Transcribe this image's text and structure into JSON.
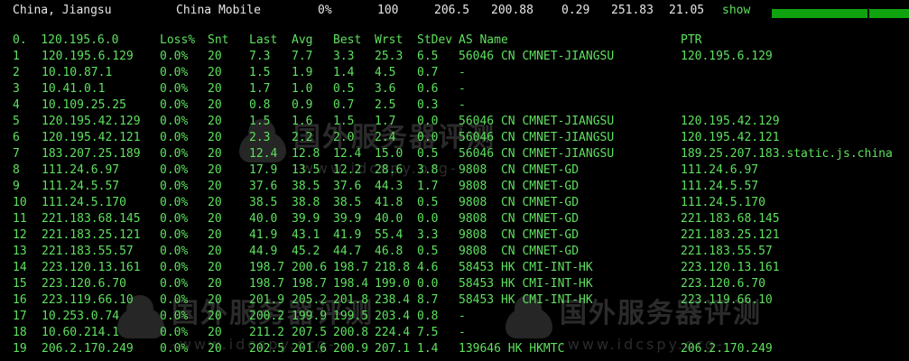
{
  "summary": {
    "location": "China, Jiangsu",
    "isp": "China Mobile",
    "loss": "0%",
    "sent": "100",
    "last": "206.5",
    "avg": "200.88",
    "best": "0.29",
    "worst": "251.83",
    "stdev": "21.05",
    "show_label": "show"
  },
  "columns": {
    "host": "0.  120.195.6.0",
    "loss": "Loss%",
    "snt": "Snt",
    "last": "Last",
    "avg": "Avg",
    "best": "Best",
    "wrst": "Wrst",
    "stdev": "StDev",
    "asname": "AS Name",
    "ptr": "PTR"
  },
  "hops": [
    {
      "n": "1",
      "ip": "120.195.6.129",
      "loss": "0.0%",
      "snt": "20",
      "last": "7.3",
      "avg": "7.7",
      "best": "3.3",
      "wrst": "25.3",
      "stdev": "6.5",
      "asname": "56046 CN CMNET-JIANGSU",
      "ptr": "120.195.6.129"
    },
    {
      "n": "2",
      "ip": "10.10.87.1",
      "loss": "0.0%",
      "snt": "20",
      "last": "1.5",
      "avg": "1.9",
      "best": "1.4",
      "wrst": "4.5",
      "stdev": "0.7",
      "asname": "-",
      "ptr": ""
    },
    {
      "n": "3",
      "ip": "10.41.0.1",
      "loss": "0.0%",
      "snt": "20",
      "last": "1.7",
      "avg": "1.0",
      "best": "0.5",
      "wrst": "3.6",
      "stdev": "0.6",
      "asname": "-",
      "ptr": ""
    },
    {
      "n": "4",
      "ip": "10.109.25.25",
      "loss": "0.0%",
      "snt": "20",
      "last": "0.8",
      "avg": "0.9",
      "best": "0.7",
      "wrst": "2.5",
      "stdev": "0.3",
      "asname": "-",
      "ptr": ""
    },
    {
      "n": "5",
      "ip": "120.195.42.129",
      "loss": "0.0%",
      "snt": "20",
      "last": "1.5",
      "avg": "1.6",
      "best": "1.5",
      "wrst": "1.7",
      "stdev": "0.0",
      "asname": "56046 CN CMNET-JIANGSU",
      "ptr": "120.195.42.129"
    },
    {
      "n": "6",
      "ip": "120.195.42.121",
      "loss": "0.0%",
      "snt": "20",
      "last": "2.3",
      "avg": "2.2",
      "best": "2.0",
      "wrst": "2.4",
      "stdev": "0.0",
      "asname": "56046 CN CMNET-JIANGSU",
      "ptr": "120.195.42.121"
    },
    {
      "n": "7",
      "ip": "183.207.25.189",
      "loss": "0.0%",
      "snt": "20",
      "last": "12.4",
      "avg": "12.8",
      "best": "12.4",
      "wrst": "15.0",
      "stdev": "0.5",
      "asname": "56046 CN CMNET-JIANGSU",
      "ptr": "189.25.207.183.static.js.china"
    },
    {
      "n": "8",
      "ip": "111.24.6.97",
      "loss": "0.0%",
      "snt": "20",
      "last": "17.9",
      "avg": "13.5",
      "best": "12.2",
      "wrst": "28.6",
      "stdev": "3.8",
      "asname": "9808  CN CMNET-GD",
      "ptr": "111.24.6.97"
    },
    {
      "n": "9",
      "ip": "111.24.5.57",
      "loss": "0.0%",
      "snt": "20",
      "last": "37.6",
      "avg": "38.5",
      "best": "37.6",
      "wrst": "44.3",
      "stdev": "1.7",
      "asname": "9808  CN CMNET-GD",
      "ptr": "111.24.5.57"
    },
    {
      "n": "10",
      "ip": "111.24.5.170",
      "loss": "0.0%",
      "snt": "20",
      "last": "38.5",
      "avg": "38.8",
      "best": "38.5",
      "wrst": "41.8",
      "stdev": "0.5",
      "asname": "9808  CN CMNET-GD",
      "ptr": "111.24.5.170"
    },
    {
      "n": "11",
      "ip": "221.183.68.145",
      "loss": "0.0%",
      "snt": "20",
      "last": "40.0",
      "avg": "39.9",
      "best": "39.9",
      "wrst": "40.0",
      "stdev": "0.0",
      "asname": "9808  CN CMNET-GD",
      "ptr": "221.183.68.145"
    },
    {
      "n": "12",
      "ip": "221.183.25.121",
      "loss": "0.0%",
      "snt": "20",
      "last": "41.9",
      "avg": "43.1",
      "best": "41.9",
      "wrst": "55.4",
      "stdev": "3.3",
      "asname": "9808  CN CMNET-GD",
      "ptr": "221.183.25.121"
    },
    {
      "n": "13",
      "ip": "221.183.55.57",
      "loss": "0.0%",
      "snt": "20",
      "last": "44.9",
      "avg": "45.2",
      "best": "44.7",
      "wrst": "46.8",
      "stdev": "0.5",
      "asname": "9808  CN CMNET-GD",
      "ptr": "221.183.55.57"
    },
    {
      "n": "14",
      "ip": "223.120.13.161",
      "loss": "0.0%",
      "snt": "20",
      "last": "198.7",
      "avg": "200.6",
      "best": "198.7",
      "wrst": "218.8",
      "stdev": "4.6",
      "asname": "58453 HK CMI-INT-HK",
      "ptr": "223.120.13.161"
    },
    {
      "n": "15",
      "ip": "223.120.6.70",
      "loss": "0.0%",
      "snt": "20",
      "last": "198.7",
      "avg": "198.7",
      "best": "198.4",
      "wrst": "199.0",
      "stdev": "0.0",
      "asname": "58453 HK CMI-INT-HK",
      "ptr": "223.120.6.70"
    },
    {
      "n": "16",
      "ip": "223.119.66.10",
      "loss": "0.0%",
      "snt": "20",
      "last": "201.9",
      "avg": "205.2",
      "best": "201.8",
      "wrst": "238.4",
      "stdev": "8.7",
      "asname": "58453 HK CMI-INT-HK",
      "ptr": "223.119.66.10"
    },
    {
      "n": "17",
      "ip": "10.253.0.74",
      "loss": "0.0%",
      "snt": "20",
      "last": "200.2",
      "avg": "199.9",
      "best": "199.5",
      "wrst": "203.4",
      "stdev": "0.8",
      "asname": "-",
      "ptr": ""
    },
    {
      "n": "18",
      "ip": "10.60.214.1",
      "loss": "0.0%",
      "snt": "20",
      "last": "211.2",
      "avg": "207.5",
      "best": "200.8",
      "wrst": "224.4",
      "stdev": "7.5",
      "asname": "-",
      "ptr": ""
    },
    {
      "n": "19",
      "ip": "206.2.170.249",
      "loss": "0.0%",
      "snt": "20",
      "last": "202.5",
      "avg": "201.6",
      "best": "200.9",
      "wrst": "207.1",
      "stdev": "1.4",
      "asname": "139646 HK HKMTC",
      "ptr": "206.2.170.249"
    }
  ],
  "watermark": {
    "text": "国外服务器评测",
    "url": "-www.idcspy.org-"
  },
  "colors": {
    "background": "#000000",
    "text_green": "#5ee05e",
    "header_white": "#e6e6e6",
    "bar_green": "#0fa30f"
  }
}
